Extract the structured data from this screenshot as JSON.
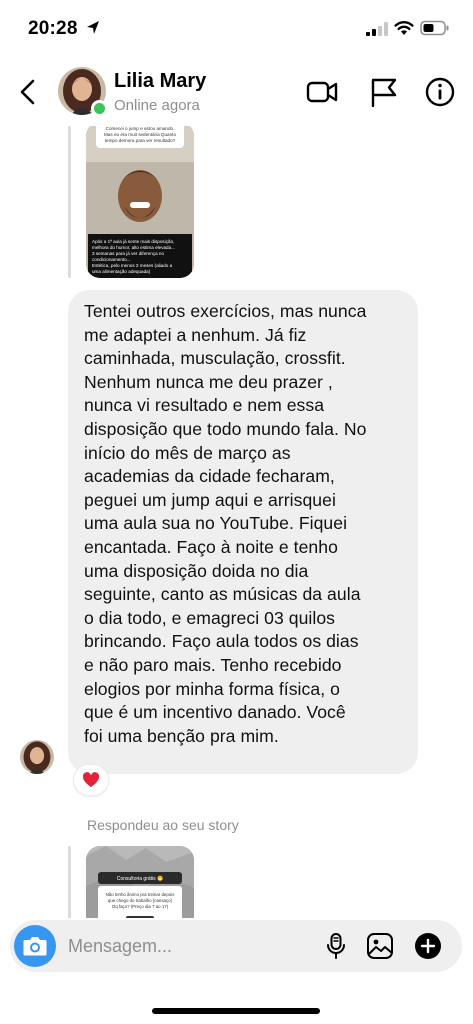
{
  "status_bar": {
    "time": "20:28"
  },
  "header": {
    "contact_name": "Lilia Mary",
    "contact_status": "Online agora",
    "icons": [
      "back-icon",
      "video-call-icon",
      "flag-icon",
      "info-icon"
    ]
  },
  "story_reply_1": {
    "top_text": "Comecei o jump e estou amando. Mas eu era muit sedentária Quanto tempo demora para ver resultado?",
    "bottom_text": "Após a 1ª aula já sente mais disposição, melhora do humor, alto estima elevada... 3 semanas para já ver diferença no condicionamento... Estética, pelo menos 3 meses (aliado a uma alimentação adequada)"
  },
  "message": {
    "text": "Tentei outros exercícios, mas nunca\nme adaptei a nenhum. Já fiz\ncaminhada, musculação, crossfit.\nNenhum nunca me deu prazer ,\n nunca vi resultado e nem essa\ndisposição que todo mundo fala. No\ninício do mês de março as\nacademias da cidade fecharam,\npeguei um jump aqui e arrisquei\numa aula sua no YouTube. Fiquei\nencantada. Faço  à noite e tenho\numa disposição doida no dia\nseguinte, canto as músicas da aula\no dia todo, e emagreci 03 quilos\nbrincando. Faço aula todos os dias\ne não paro mais.  Tenho recebido\nelogios por minha forma física, o\nque  é um incentivo danado. Você\nfoi uma benção pra mim.",
    "reaction": "❤️"
  },
  "replied_label": "Respondeu ao seu story",
  "story_reply_2": {
    "header": "Consultoria grátis 😁",
    "text": "Não tenho ânimo pra treinar depois que chego do trabalho (cansaço) Oq faço? (Preço dia 7 ao 17)"
  },
  "composer": {
    "placeholder": "Mensagem..."
  },
  "colors": {
    "accent": "#3797f0",
    "online": "#3ec25b",
    "bubble": "#efefef",
    "heart": "#e0223a"
  }
}
